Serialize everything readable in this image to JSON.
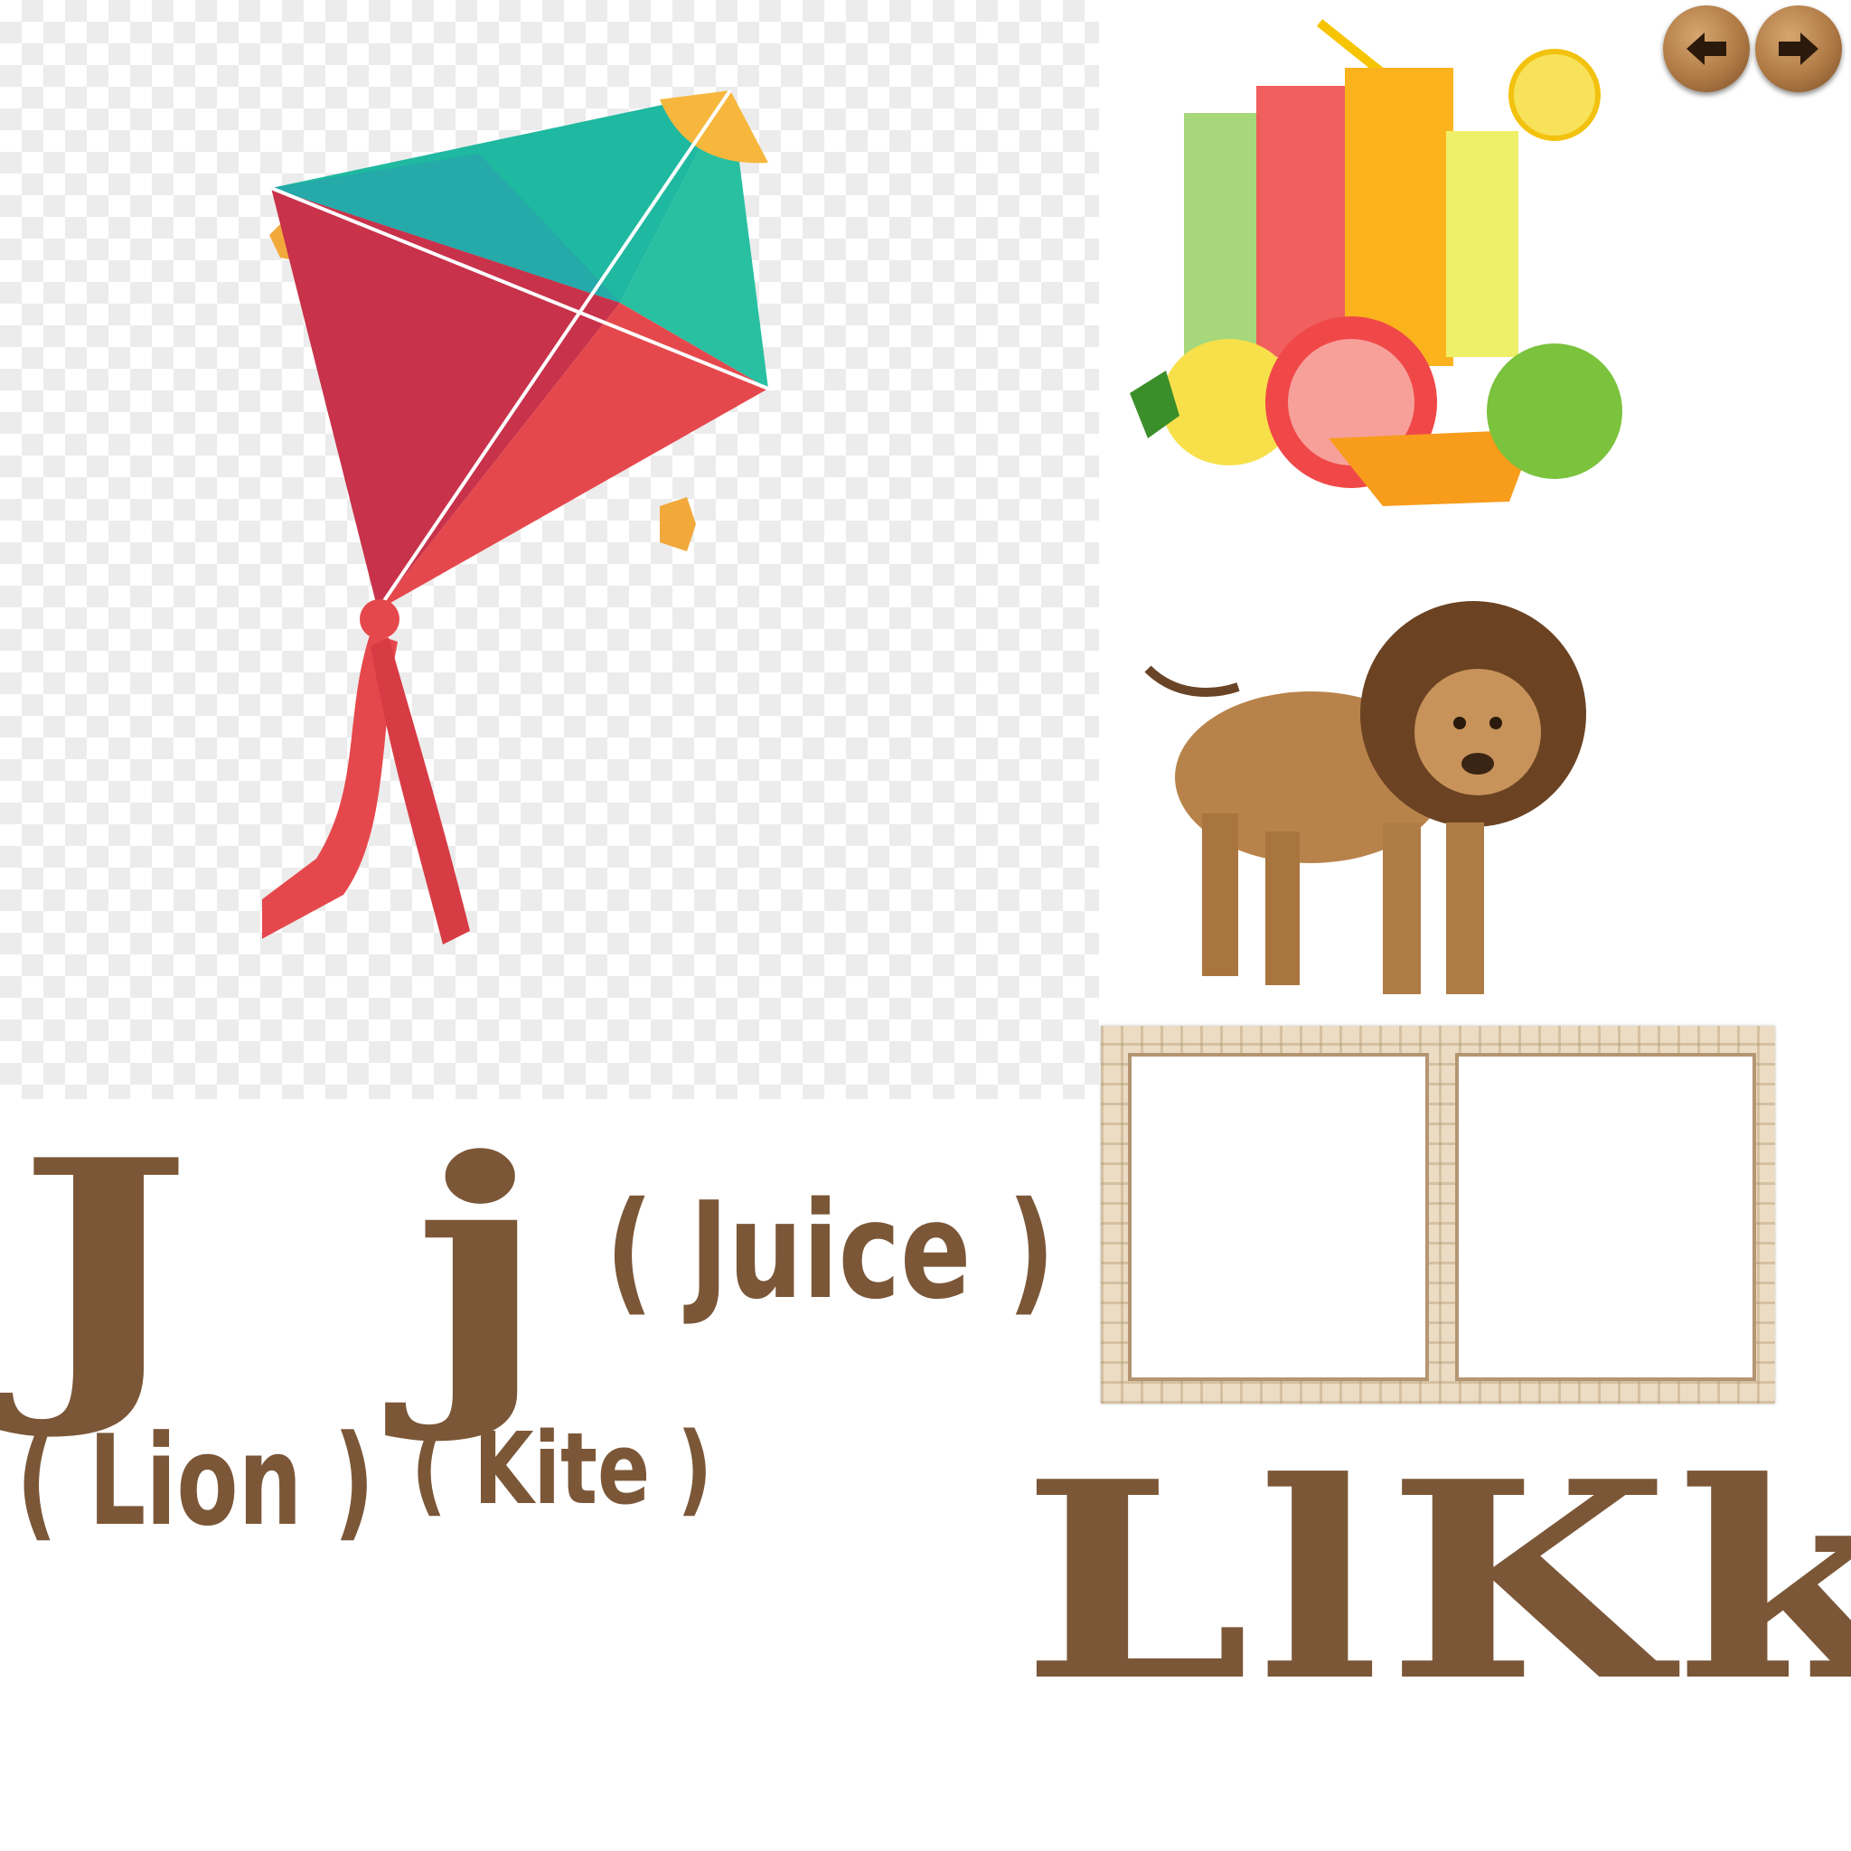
{
  "nav": {
    "prev_icon": "arrow-left-icon",
    "next_icon": "arrow-right-icon"
  },
  "pictures": {
    "kite": "kite",
    "juice": "juice",
    "lion": "lion"
  },
  "letters": {
    "j_pair": "J j",
    "lk_pair": "LlKk"
  },
  "words": {
    "juice": "( Juice )",
    "lion": "( Lion )",
    "kite": "( Kite )"
  },
  "drop_frame": {
    "slots": 2
  },
  "colors": {
    "text_brown": "#7b5738",
    "frame_beige": "#ecdcc4",
    "button_wood": "#b07a45"
  }
}
